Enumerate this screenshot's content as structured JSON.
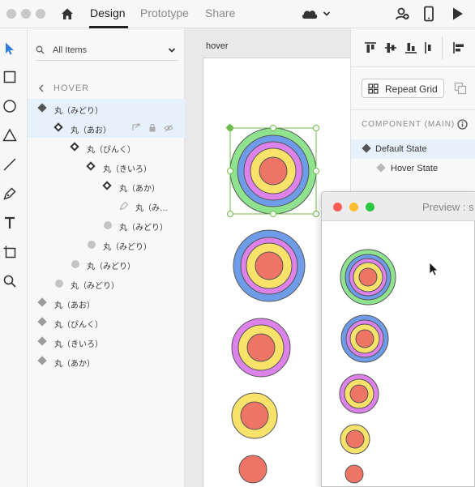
{
  "topbar": {
    "tabs": [
      {
        "label": "Design",
        "active": true
      },
      {
        "label": "Prototype",
        "active": false
      },
      {
        "label": "Share",
        "active": false
      }
    ],
    "icons": [
      "home-icon",
      "cloud-icon",
      "chevron-down-icon",
      "user-add-icon",
      "mobile-device-icon",
      "play-icon"
    ]
  },
  "tools": [
    "select-tool-icon",
    "rectangle-tool-icon",
    "ellipse-tool-icon",
    "polygon-tool-icon",
    "line-tool-icon",
    "pen-tool-icon",
    "text-tool-icon",
    "artboard-tool-icon",
    "zoom-tool-icon"
  ],
  "layers": {
    "filter_label": "All Items",
    "back_label": "HOVER",
    "rows": [
      {
        "label": "丸（みどり）",
        "icon": "diamond-filled",
        "indent": 0,
        "selected": true
      },
      {
        "label": "丸（あお）",
        "icon": "diamond-outline",
        "indent": 1,
        "selected": true
      },
      {
        "label": "丸（ぴんく）",
        "icon": "diamond-outline",
        "indent": 2,
        "selected": false
      },
      {
        "label": "丸（きいろ）",
        "icon": "diamond-outline",
        "indent": 3,
        "selected": false
      },
      {
        "label": "丸（あか）",
        "icon": "diamond-outline",
        "indent": 4,
        "selected": false
      },
      {
        "label": "丸（み…",
        "icon": "pen",
        "indent": 5,
        "selected": false
      },
      {
        "label": "丸（みどり）",
        "icon": "circle",
        "indent": 4,
        "selected": false
      },
      {
        "label": "丸（みどり）",
        "icon": "circle",
        "indent": 3,
        "selected": false
      },
      {
        "label": "丸（みどり）",
        "icon": "circle",
        "indent": 2,
        "selected": false
      },
      {
        "label": "丸（みどり）",
        "icon": "circle",
        "indent": 1,
        "selected": false
      },
      {
        "label": "丸（あお）",
        "icon": "diamond-gray",
        "indent": 0,
        "selected": false
      },
      {
        "label": "丸（ぴんく）",
        "icon": "diamond-gray",
        "indent": 0,
        "selected": false
      },
      {
        "label": "丸（きいろ）",
        "icon": "diamond-gray",
        "indent": 0,
        "selected": false
      },
      {
        "label": "丸（あか）",
        "icon": "diamond-gray",
        "indent": 0,
        "selected": false
      }
    ]
  },
  "canvas": {
    "artboard_label": "hover"
  },
  "props": {
    "repeat_grid_label": "Repeat Grid",
    "component_title": "COMPONENT (MAIN)",
    "states": [
      {
        "label": "Default State",
        "selected": true
      },
      {
        "label": "Hover State",
        "selected": false
      }
    ]
  },
  "preview": {
    "title": "Preview : s"
  },
  "colors": {
    "green": "#8fe38f",
    "blue": "#6e9ce8",
    "pink": "#dd82ea",
    "yellow": "#f9e26a",
    "red": "#ee7565",
    "selection": "#6dbb4a",
    "select_tool": "#2f7de1",
    "close": "#ff5f57",
    "minimize": "#febc2e",
    "zoom": "#28c840"
  }
}
